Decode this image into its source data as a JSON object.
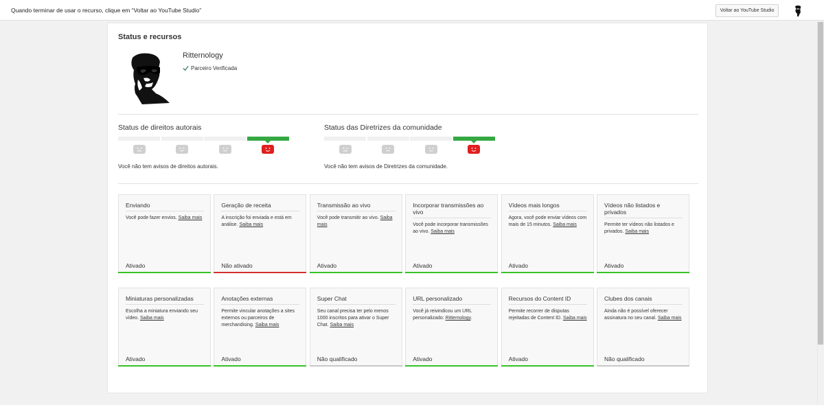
{
  "topbar": {
    "message": "Quando terminar de usar o recurso, clique em “Voltar ao YouTube Studio”",
    "back_button": "Voltar ao YouTube Studio"
  },
  "page": {
    "title": "Status e recursos",
    "channel_name": "Ritternology",
    "verified_label": "Parceiro Verificada"
  },
  "copyright": {
    "heading": "Status de direitos autorais",
    "note": "Você não tem avisos de direitos autorais.",
    "active_level": 4
  },
  "community": {
    "heading": "Status das Diretrizes da comunidade",
    "note": "Você não tem avisos de Diretrizes da comunidade.",
    "active_level": 4
  },
  "colors": {
    "enabled": "#35c125",
    "disabled": "#d32f2f",
    "not_qualified": "#c8c8c8",
    "meter_active": "#35a843",
    "face_active": "#e01f1f"
  },
  "features": [
    {
      "title": "Enviando",
      "desc": "Você pode fazer envios.",
      "link": "Saiba mais",
      "status": "Ativado",
      "state": "enabled"
    },
    {
      "title": "Geração de receita",
      "desc": "A inscrição foi enviada e está em análise.",
      "link": "Saiba mais",
      "status": "Não ativado",
      "state": "disabled"
    },
    {
      "title": "Transmissão ao vivo",
      "desc": "Você pode transmitir ao vivo.",
      "link": "Saiba mais",
      "status": "Ativado",
      "state": "enabled"
    },
    {
      "title": "Incorporar transmissões ao vivo",
      "desc": "Você pode incorporar transmissões ao vivo.",
      "link": "Saiba mais",
      "status": "Ativado",
      "state": "enabled"
    },
    {
      "title": "Vídeos mais longos",
      "desc": "Agora, você pode enviar vídeos com mais de 15 minutos.",
      "link": "Saiba mais",
      "status": "Ativado",
      "state": "enabled"
    },
    {
      "title": "Vídeos não listados e privados",
      "desc": "Permite ter vídeos não listados e privados.",
      "link": "Saiba mais",
      "status": "Ativado",
      "state": "enabled"
    },
    {
      "title": "Miniaturas personalizadas",
      "desc": "Escolha a miniatura enviando seu vídeo.",
      "link": "Saiba mais",
      "status": "Ativado",
      "state": "enabled"
    },
    {
      "title": "Anotações externas",
      "desc": "Permite vincular anotações a sites externos ou parceiros de merchandising.",
      "link": "Saiba mais",
      "status": "Ativado",
      "state": "enabled"
    },
    {
      "title": "Super Chat",
      "desc": "Seu canal precisa ter pelo menos 1000 inscritos para ativar o Super Chat.",
      "link": "Saiba mais",
      "status": "Não qualificado",
      "state": "not_qualified"
    },
    {
      "title": "URL personalizado",
      "desc": "Você já reivindicou um URL personalizado:",
      "link": "Ritternology",
      "suffix": ".",
      "status": "Ativado",
      "state": "enabled"
    },
    {
      "title": "Recursos do Content ID",
      "desc": "Permite recorrer de disputas rejeitadas de Content ID.",
      "link": "Saiba mais",
      "status": "Ativado",
      "state": "enabled"
    },
    {
      "title": "Clubes dos canais",
      "desc": "Ainda não é possível oferecer assinatura no seu canal.",
      "link": "Saiba mais",
      "status": "Não qualificado",
      "state": "not_qualified"
    }
  ]
}
